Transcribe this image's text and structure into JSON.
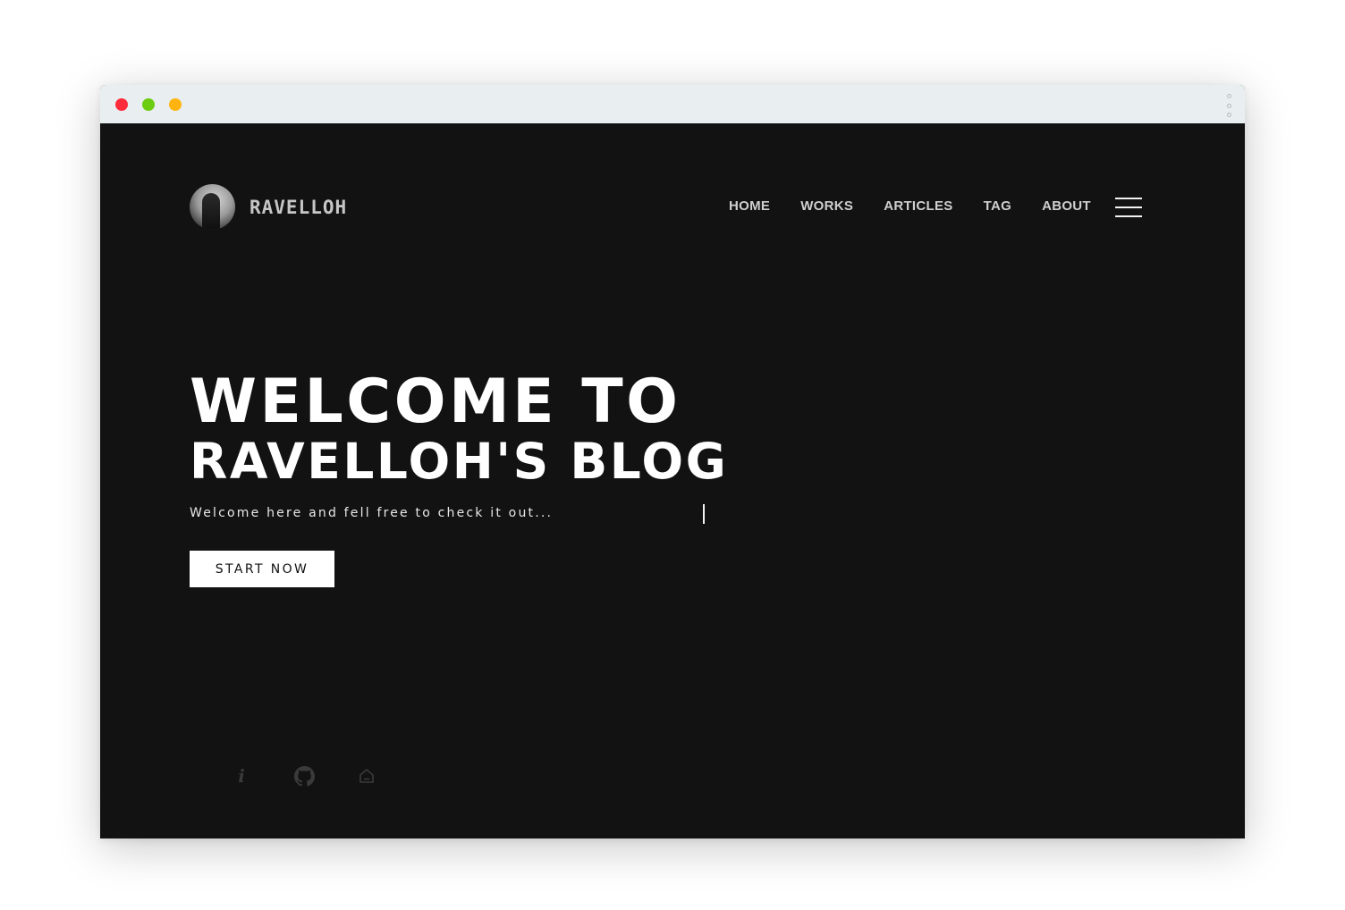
{
  "site": {
    "brand": "RAVELLOH",
    "nav": [
      {
        "label": "HOME"
      },
      {
        "label": "WORKS"
      },
      {
        "label": "ARTICLES"
      },
      {
        "label": "TAG"
      },
      {
        "label": "ABOUT"
      }
    ]
  },
  "hero": {
    "title_line1": "WELCOME TO",
    "title_line2": "RAVELLOH'S BLOG",
    "subtitle": "Welcome here and fell free to check it out...",
    "cta_label": "START NOW"
  },
  "socials": [
    {
      "icon": "info-icon"
    },
    {
      "icon": "github-icon"
    },
    {
      "icon": "home-icon"
    }
  ],
  "colors": {
    "background": "#121212",
    "titlebar": "#e9eff0",
    "traffic_red": "#ff2d3b",
    "traffic_green": "#6ccc12",
    "traffic_yellow": "#ffb30f",
    "text": "#ffffff",
    "nav_text": "#cfcfcf",
    "social_icon": "#3a3a3a"
  }
}
